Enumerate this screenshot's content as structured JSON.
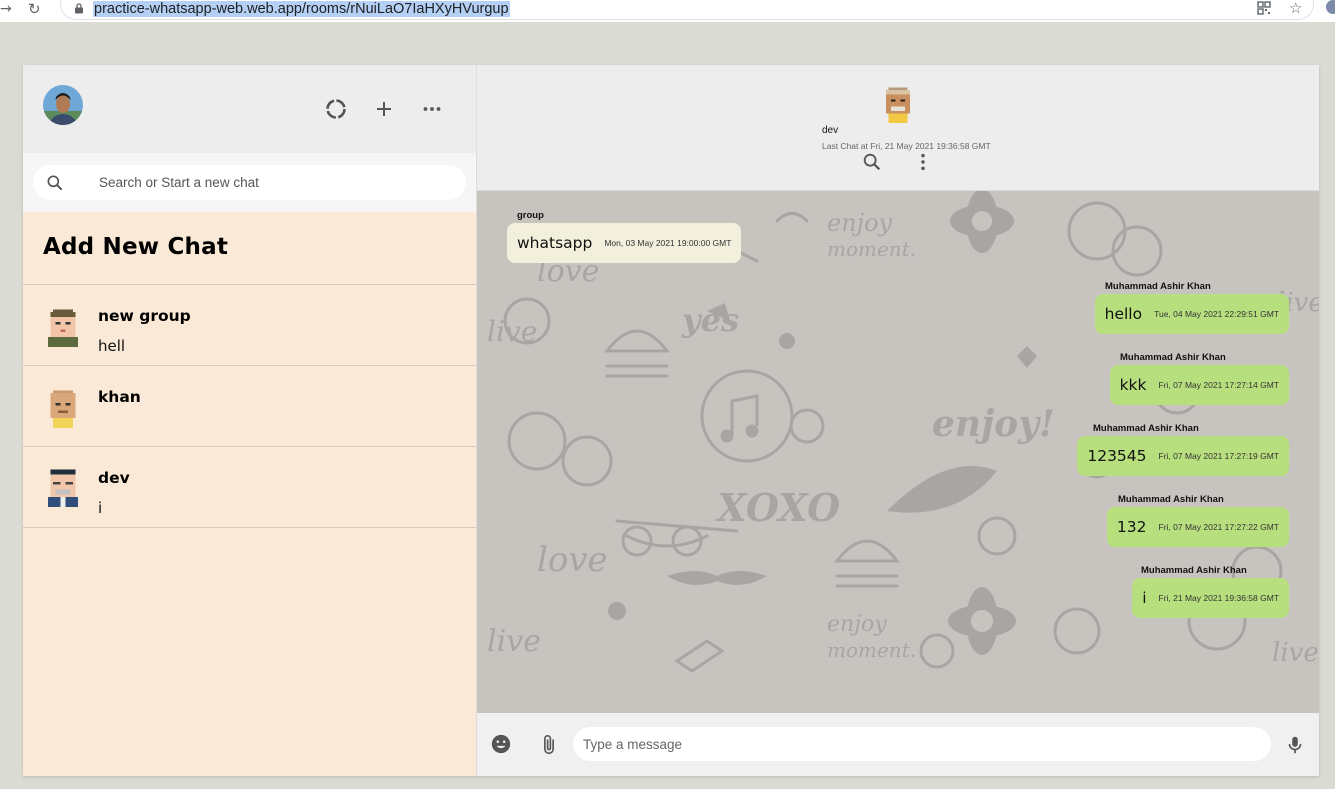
{
  "browser": {
    "url": "practice-whatsapp-web.web.app/rooms/rNuiLaO7IaHXyHVurgup"
  },
  "sidebar": {
    "search": {
      "placeholder": "Search or Start a new chat",
      "value": ""
    },
    "add_chat_label": "Add New Chat",
    "chats": [
      {
        "name": "new group",
        "last_message": "hell"
      },
      {
        "name": "khan",
        "last_message": ""
      },
      {
        "name": "dev",
        "last_message": "i"
      }
    ]
  },
  "chat": {
    "room_name": "dev",
    "last_seen": "Last Chat at Fri, 21 May 2021 19:36:58 GMT",
    "messages": [
      {
        "sender": "group",
        "text": "whatsapp",
        "time": "Mon, 03 May 2021 19:00:00 GMT",
        "own": false
      },
      {
        "sender": "Muhammad Ashir Khan",
        "text": "hello",
        "time": "Tue, 04 May 2021 22:29:51 GMT",
        "own": true
      },
      {
        "sender": "Muhammad Ashir Khan",
        "text": "kkk",
        "time": "Fri, 07 May 2021 17:27:14 GMT",
        "own": true
      },
      {
        "sender": "Muhammad Ashir Khan",
        "text": "123545",
        "time": "Fri, 07 May 2021 17:27:19 GMT",
        "own": true
      },
      {
        "sender": "Muhammad Ashir Khan",
        "text": "132",
        "time": "Fri, 07 May 2021 17:27:22 GMT",
        "own": true
      },
      {
        "sender": "Muhammad Ashir Khan",
        "text": "i",
        "time": "Fri, 21 May 2021 19:36:58 GMT",
        "own": true
      }
    ],
    "input": {
      "placeholder": "Type a message",
      "value": ""
    }
  },
  "colors": {
    "sidebar_bg": "#f9e9d6",
    "header_bg": "#ededed",
    "sent_bubble": "#b8df7e",
    "received_bubble": "#f3efdd",
    "chat_bg": "#c7c4c0"
  },
  "icons": {
    "browser": [
      "back-arrow-icon",
      "reload-icon",
      "lock-icon",
      "qr-icon",
      "star-icon"
    ],
    "sidebar_header": [
      "status-icon",
      "new-chat-icon",
      "more-icon"
    ],
    "chat_header": [
      "search-icon",
      "menu-icon"
    ],
    "footer": [
      "emoji-icon",
      "attach-icon",
      "mic-icon"
    ]
  }
}
